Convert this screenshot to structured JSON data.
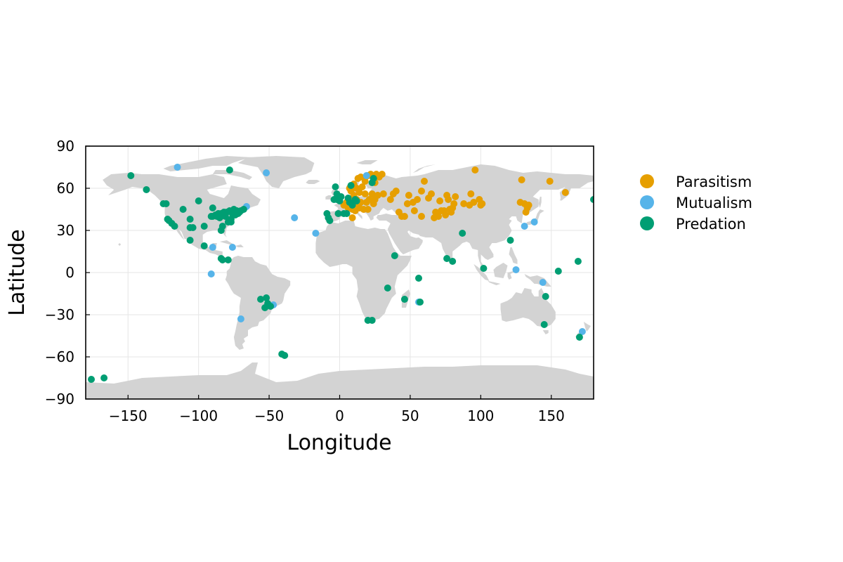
{
  "chart_data": {
    "type": "scatter",
    "xlabel": "Longitude",
    "ylabel": "Latitude",
    "xlim": [
      -180,
      180
    ],
    "ylim": [
      -90,
      90
    ],
    "xticks": [
      -150,
      -100,
      -50,
      0,
      50,
      100,
      150
    ],
    "yticks": [
      -90,
      -60,
      -30,
      0,
      30,
      60,
      90
    ],
    "grid": true,
    "legend_position": "outside-right",
    "land_color": "#d3d3d3",
    "series": [
      {
        "name": "Parasitism",
        "color": "#e69f00",
        "points": [
          [
            5,
            50
          ],
          [
            6,
            46
          ],
          [
            7,
            52
          ],
          [
            7,
            60
          ],
          [
            8,
            47
          ],
          [
            8,
            58
          ],
          [
            9,
            39
          ],
          [
            9,
            45
          ],
          [
            10,
            63
          ],
          [
            10,
            55
          ],
          [
            11,
            49
          ],
          [
            12,
            52
          ],
          [
            12,
            60
          ],
          [
            13,
            67
          ],
          [
            14,
            46
          ],
          [
            15,
            68
          ],
          [
            15,
            50
          ],
          [
            16,
            61
          ],
          [
            17,
            45
          ],
          [
            18,
            56
          ],
          [
            18,
            65
          ],
          [
            19,
            50
          ],
          [
            20,
            69
          ],
          [
            21,
            52
          ],
          [
            22,
            70
          ],
          [
            23,
            56
          ],
          [
            24,
            49
          ],
          [
            25,
            64
          ],
          [
            26,
            70
          ],
          [
            27,
            55
          ],
          [
            28,
            68
          ],
          [
            30,
            70
          ],
          [
            31,
            56
          ],
          [
            20,
            45
          ],
          [
            25,
            52
          ],
          [
            14,
            57
          ],
          [
            11,
            44
          ],
          [
            3,
            48
          ],
          [
            36,
            52
          ],
          [
            38,
            56
          ],
          [
            40,
            58
          ],
          [
            42,
            43
          ],
          [
            44,
            40
          ],
          [
            46,
            40
          ],
          [
            48,
            49
          ],
          [
            49,
            55
          ],
          [
            52,
            50
          ],
          [
            53,
            44
          ],
          [
            55,
            52
          ],
          [
            58,
            40
          ],
          [
            58,
            58
          ],
          [
            60,
            65
          ],
          [
            63,
            53
          ],
          [
            65,
            56
          ],
          [
            67,
            39
          ],
          [
            68,
            43
          ],
          [
            70,
            40
          ],
          [
            71,
            51
          ],
          [
            72,
            44
          ],
          [
            74,
            44
          ],
          [
            75,
            41
          ],
          [
            76,
            55
          ],
          [
            77,
            52
          ],
          [
            78,
            45
          ],
          [
            79,
            43
          ],
          [
            80,
            46
          ],
          [
            81,
            49
          ],
          [
            82,
            54
          ],
          [
            88,
            49
          ],
          [
            92,
            48
          ],
          [
            93,
            56
          ],
          [
            95,
            50
          ],
          [
            96,
            73
          ],
          [
            99,
            52
          ],
          [
            100,
            48
          ],
          [
            101,
            49
          ],
          [
            128,
            50
          ],
          [
            129,
            66
          ],
          [
            131,
            49
          ],
          [
            132,
            43
          ],
          [
            133,
            46
          ],
          [
            134,
            48
          ],
          [
            149,
            65
          ],
          [
            160,
            57
          ]
        ]
      },
      {
        "name": "Mutualism",
        "color": "#56b4e9",
        "points": [
          [
            -115,
            75
          ],
          [
            -52,
            71
          ],
          [
            -32,
            39
          ],
          [
            -17,
            28
          ],
          [
            -90,
            18
          ],
          [
            -76,
            18
          ],
          [
            -91,
            -1
          ],
          [
            -70,
            -33
          ],
          [
            -47,
            -23
          ],
          [
            -66,
            47
          ],
          [
            19,
            69
          ],
          [
            56,
            -21
          ],
          [
            125,
            2
          ],
          [
            131,
            33
          ],
          [
            138,
            36
          ],
          [
            144,
            -7
          ],
          [
            172,
            -42
          ]
        ]
      },
      {
        "name": "Predation",
        "color": "#009e73",
        "points": [
          [
            -148,
            69
          ],
          [
            -137,
            59
          ],
          [
            -125,
            49
          ],
          [
            -123,
            49
          ],
          [
            -122,
            38
          ],
          [
            -121,
            37
          ],
          [
            -119,
            35
          ],
          [
            -117,
            33
          ],
          [
            -111,
            45
          ],
          [
            -106,
            38
          ],
          [
            -106,
            32
          ],
          [
            -104,
            32
          ],
          [
            -106,
            23
          ],
          [
            -100,
            51
          ],
          [
            -96,
            33
          ],
          [
            -96,
            19
          ],
          [
            -91,
            40
          ],
          [
            -90,
            46
          ],
          [
            -90,
            40
          ],
          [
            -88,
            41
          ],
          [
            -87,
            40
          ],
          [
            -86,
            42
          ],
          [
            -85,
            39
          ],
          [
            -84,
            42
          ],
          [
            -84,
            30
          ],
          [
            -83,
            33
          ],
          [
            -82,
            43
          ],
          [
            -81,
            40
          ],
          [
            -80,
            43
          ],
          [
            -79,
            36
          ],
          [
            -78,
            44
          ],
          [
            -77,
            38
          ],
          [
            -77,
            36
          ],
          [
            -76,
            42
          ],
          [
            -75,
            45
          ],
          [
            -74,
            41
          ],
          [
            -73,
            44
          ],
          [
            -72,
            42
          ],
          [
            -71,
            43
          ],
          [
            -70,
            44
          ],
          [
            -68,
            45
          ],
          [
            -84,
            10
          ],
          [
            -83,
            9
          ],
          [
            -79,
            9
          ],
          [
            -78,
            73
          ],
          [
            -56,
            -19
          ],
          [
            -53,
            -25
          ],
          [
            -52,
            -18
          ],
          [
            -51,
            -22
          ],
          [
            -49,
            -24
          ],
          [
            -41,
            -58
          ],
          [
            -39,
            -59
          ],
          [
            -9,
            42
          ],
          [
            -8,
            39
          ],
          [
            -7,
            37
          ],
          [
            -4,
            52
          ],
          [
            -3,
            61
          ],
          [
            -2,
            56
          ],
          [
            -2,
            52
          ],
          [
            -1,
            42
          ],
          [
            0,
            51
          ],
          [
            1,
            54
          ],
          [
            3,
            42
          ],
          [
            5,
            42
          ],
          [
            6,
            53
          ],
          [
            7,
            50
          ],
          [
            8,
            62
          ],
          [
            9,
            48
          ],
          [
            11,
            52
          ],
          [
            12,
            51
          ],
          [
            23,
            64
          ],
          [
            24,
            67
          ],
          [
            20,
            -34
          ],
          [
            23,
            -34
          ],
          [
            34,
            -11
          ],
          [
            39,
            12
          ],
          [
            46,
            -19
          ],
          [
            56,
            -4
          ],
          [
            57,
            -21
          ],
          [
            76,
            10
          ],
          [
            80,
            8
          ],
          [
            87,
            28
          ],
          [
            102,
            3
          ],
          [
            121,
            23
          ],
          [
            145,
            -37
          ],
          [
            146,
            -17
          ],
          [
            155,
            1
          ],
          [
            169,
            8
          ],
          [
            170,
            -46
          ],
          [
            180,
            52
          ],
          [
            -176,
            -76
          ],
          [
            -167,
            -75
          ]
        ]
      }
    ]
  }
}
